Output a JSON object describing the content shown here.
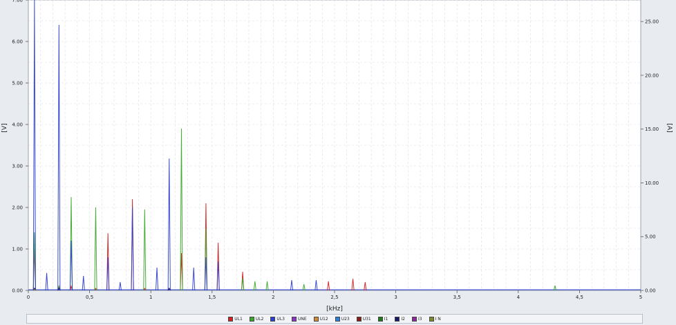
{
  "chart_data": {
    "type": "line",
    "title": "",
    "xlabel": "[kHz]",
    "ylabel": "[V]",
    "y2label": "[A]",
    "xlim": [
      0,
      5
    ],
    "ylim": [
      0,
      7.0
    ],
    "y2lim": [
      0,
      27.0
    ],
    "x_ticks": [
      "0",
      "0,5",
      "1",
      "1,5",
      "2",
      "2,5",
      "3",
      "3,5",
      "4",
      "4,5",
      "5"
    ],
    "y_ticks": [
      "0.00",
      "1.00",
      "2.00",
      "3.00",
      "4.00",
      "5.00",
      "6.00",
      "7.00"
    ],
    "y2_ticks": [
      "0.00",
      "5.00",
      "10.00",
      "15.00",
      "20.00",
      "25.00"
    ],
    "grid": true,
    "legend_position": "bottom",
    "series": [
      {
        "name": "UL1",
        "color": "#d42020",
        "axis": "left",
        "x": [
          0.05,
          0.25,
          0.35,
          0.55,
          0.65,
          0.85,
          0.95,
          1.15,
          1.25,
          1.45,
          1.55,
          1.75,
          2.45,
          2.65,
          2.75
        ],
        "values": [
          1.0,
          0.1,
          0.1,
          0.05,
          1.38,
          2.2,
          0.05,
          0.05,
          0.9,
          2.1,
          1.15,
          0.45,
          0.22,
          0.28,
          0.2
        ]
      },
      {
        "name": "UL2",
        "color": "#3aa82c",
        "axis": "left",
        "x": [
          0.05,
          0.25,
          0.35,
          0.55,
          0.95,
          1.25,
          1.45,
          1.75,
          1.85,
          1.95,
          2.25,
          4.3
        ],
        "values": [
          1.4,
          0.1,
          2.25,
          2.0,
          1.95,
          3.9,
          1.5,
          0.3,
          0.22,
          0.22,
          0.15,
          0.12
        ]
      },
      {
        "name": "UL3",
        "color": "#2c3fd0",
        "axis": "left",
        "x": [
          0.05,
          0.15,
          0.25,
          0.35,
          0.45,
          0.65,
          0.75,
          0.85,
          1.05,
          1.15,
          1.35,
          1.45,
          1.55,
          2.15,
          2.35
        ],
        "values": [
          7.0,
          0.42,
          6.4,
          1.2,
          0.35,
          0.8,
          0.2,
          2.0,
          0.55,
          3.18,
          0.55,
          0.8,
          0.7,
          0.25,
          0.25
        ]
      },
      {
        "name": "UNE",
        "color": "#8a35c8",
        "axis": "left",
        "x": [
          0.05
        ],
        "values": [
          0.05
        ]
      },
      {
        "name": "U12",
        "color": "#d08a3c",
        "axis": "left",
        "x": [
          0.05
        ],
        "values": [
          0.05
        ]
      },
      {
        "name": "U23",
        "color": "#2f7fd8",
        "axis": "left",
        "x": [
          0.05
        ],
        "values": [
          0.05
        ]
      },
      {
        "name": "U31",
        "color": "#8b1a1a",
        "axis": "left",
        "x": [
          0.05
        ],
        "values": [
          0.05
        ]
      },
      {
        "name": "I1",
        "color": "#1f7a1f",
        "axis": "right",
        "x": [
          0.05
        ],
        "values": [
          0.1
        ]
      },
      {
        "name": "I2",
        "color": "#18186e",
        "axis": "right",
        "x": [
          0.05,
          0.25,
          1.15
        ],
        "values": [
          0.2,
          0.2,
          0.2
        ]
      },
      {
        "name": "I3",
        "color": "#8a2a9a",
        "axis": "right",
        "x": [
          0.05
        ],
        "values": [
          0.1
        ]
      },
      {
        "name": "I N",
        "color": "#7f8a2a",
        "axis": "right",
        "x": [
          0.05
        ],
        "values": [
          0.1
        ]
      }
    ]
  }
}
